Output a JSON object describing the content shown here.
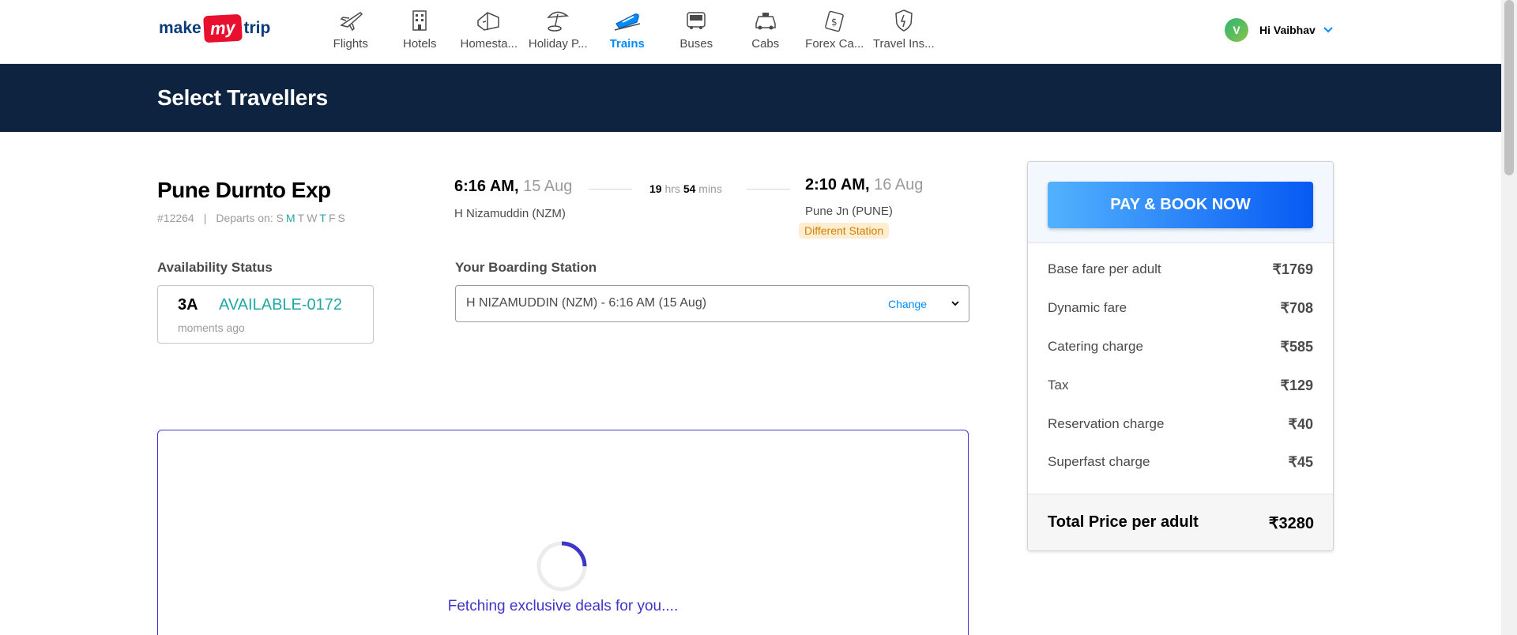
{
  "header": {
    "logo": {
      "part1": "make",
      "part2": "my",
      "part3": "trip"
    },
    "nav": [
      {
        "label": "Flights",
        "icon": "flight-icon",
        "active": false
      },
      {
        "label": "Hotels",
        "icon": "hotel-icon",
        "active": false
      },
      {
        "label": "Homesta...",
        "icon": "homestay-icon",
        "active": false
      },
      {
        "label": "Holiday P...",
        "icon": "holiday-icon",
        "active": false
      },
      {
        "label": "Trains",
        "icon": "train-icon",
        "active": true
      },
      {
        "label": "Buses",
        "icon": "bus-icon",
        "active": false
      },
      {
        "label": "Cabs",
        "icon": "cab-icon",
        "active": false
      },
      {
        "label": "Forex Ca...",
        "icon": "forex-icon",
        "active": false
      },
      {
        "label": "Travel Ins...",
        "icon": "insurance-icon",
        "active": false
      }
    ],
    "user": {
      "initial": "V",
      "greeting": "Hi Vaibhav"
    }
  },
  "page_title": "Select Travellers",
  "train": {
    "name": "Pune Durnto Exp",
    "number": "#12264",
    "separator": "|",
    "departs_label": "Departs on:",
    "days": [
      {
        "d": "S",
        "on": false
      },
      {
        "d": "M",
        "on": true
      },
      {
        "d": "T",
        "on": false
      },
      {
        "d": "W",
        "on": false
      },
      {
        "d": "T",
        "on": true
      },
      {
        "d": "F",
        "on": false
      },
      {
        "d": "S",
        "on": false
      }
    ],
    "departure": {
      "time": "6:16 AM,",
      "date": "15 Aug",
      "station": "H Nizamuddin (NZM)"
    },
    "duration": {
      "hrs": "19",
      "hrs_unit": "hrs",
      "mins": "54",
      "mins_unit": "mins"
    },
    "arrival": {
      "time": "2:10 AM,",
      "date": "16 Aug",
      "station": "Pune Jn (PUNE)",
      "badge": "Different Station"
    }
  },
  "availability": {
    "label": "Availability Status",
    "class": "3A",
    "status": "AVAILABLE-0172",
    "updated": "moments ago"
  },
  "boarding": {
    "label": "Your Boarding Station",
    "value": "H NIZAMUDDIN (NZM) - 6:16 AM (15 Aug)",
    "change": "Change"
  },
  "deals": {
    "loading_text": "Fetching exclusive deals for you...."
  },
  "fare": {
    "button": "PAY & BOOK NOW",
    "rows": [
      {
        "label": "Base fare per adult",
        "amount": "₹1769"
      },
      {
        "label": "Dynamic fare",
        "amount": "₹708"
      },
      {
        "label": "Catering charge",
        "amount": "₹585"
      },
      {
        "label": "Tax",
        "amount": "₹129"
      },
      {
        "label": "Reservation charge",
        "amount": "₹40"
      },
      {
        "label": "Superfast charge",
        "amount": "₹45"
      }
    ],
    "total_label": "Total Price per adult",
    "total_amount": "₹3280"
  },
  "colors": {
    "header_bar": "#0d2340",
    "accent_blue": "#008cff",
    "available_green": "#1fa8a0",
    "deals_purple": "#3f35c8"
  }
}
